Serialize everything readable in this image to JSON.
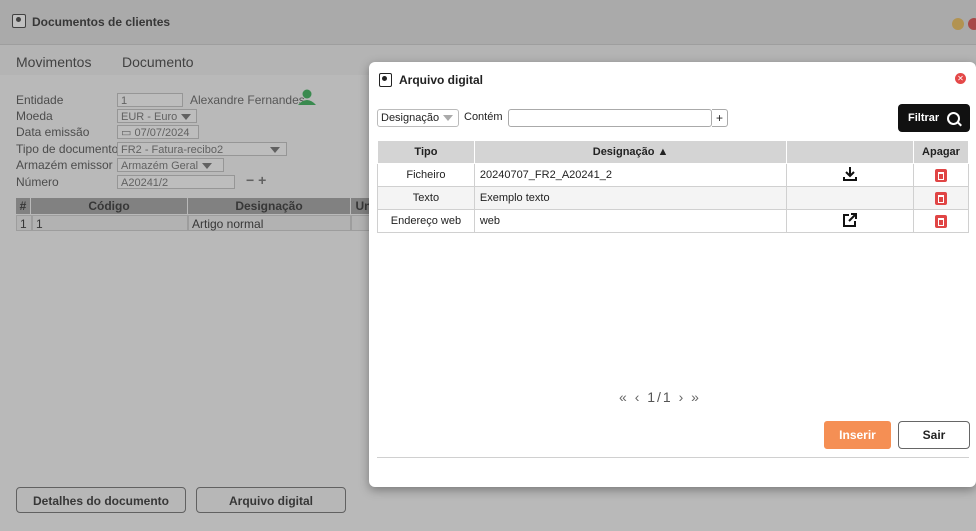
{
  "background_window": {
    "title": "Documentos de clientes",
    "menu": [
      "Movimentos",
      "Documento"
    ],
    "fields": {
      "entidade_label": "Entidade",
      "entidade_value": "1",
      "entidade_name": "Alexandre Fernandes",
      "moeda_label": "Moeda",
      "moeda_value": "EUR - Euro",
      "data_label": "Data emissão",
      "data_value": "07/07/2024",
      "tipo_label": "Tipo de documento",
      "tipo_value": "FR2 - Fatura-recibo2",
      "armazem_label": "Armazém emissor",
      "armazem_value": "Armazém Geral",
      "numero_label": "Número",
      "numero_value": "A20241/2"
    },
    "grid": {
      "headers": [
        "#",
        "Código",
        "Designação",
        "Un"
      ],
      "row": {
        "num": "1",
        "codigo": "1",
        "designacao": "Artigo normal"
      }
    },
    "buttons": {
      "detalhes": "Detalhes do documento",
      "arquivo": "Arquivo digital"
    }
  },
  "dialog": {
    "title": "Arquivo digital",
    "filter": {
      "field_selected": "Designação",
      "contains_label": "Contém",
      "search_value": "",
      "plus_label": "+",
      "filter_button": "Filtrar"
    },
    "table": {
      "headers": [
        "Tipo",
        "Designação ▲",
        "",
        "Apagar"
      ],
      "rows": [
        {
          "tipo": "Ficheiro",
          "designacao": "20240707_FR2_A20241_2",
          "action_icon": "download-icon",
          "action_glyph": "⤓"
        },
        {
          "tipo": "Texto",
          "designacao": "Exemplo texto",
          "action_icon": "",
          "action_glyph": ""
        },
        {
          "tipo": "Endereço web",
          "designacao": "web",
          "action_icon": "external-link-icon",
          "action_glyph": "⧉"
        }
      ]
    },
    "pagination": {
      "first": "«",
      "prev": "‹",
      "page": "1/1",
      "next": "›",
      "last": "»"
    },
    "buttons": {
      "insert": "Inserir",
      "exit": "Sair"
    }
  },
  "colors": {
    "accent_insert": "#f58f54",
    "filter_button": "#111111",
    "delete_icon": "#e04545",
    "user_icon": "#27a94a"
  }
}
